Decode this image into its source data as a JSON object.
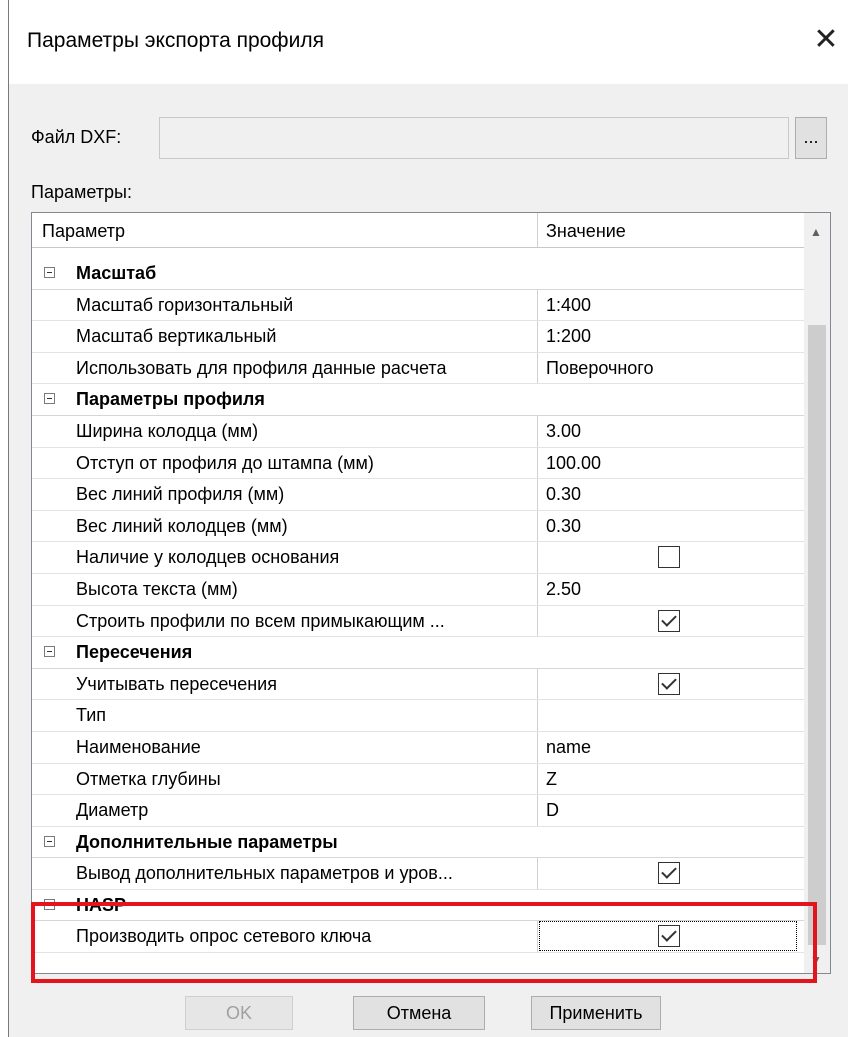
{
  "window": {
    "title": "Параметры экспорта профиля",
    "close_glyph": "✕"
  },
  "file": {
    "label": "Файл DXF:",
    "value": "",
    "browse_label": "..."
  },
  "params_label": "Параметры:",
  "grid": {
    "columns": [
      "Параметр",
      "Значение"
    ],
    "rows": [
      {
        "kind": "category",
        "name": "Масштаб"
      },
      {
        "kind": "item",
        "name": "Масштаб горизонтальный",
        "value": "1:400"
      },
      {
        "kind": "item",
        "name": "Масштаб вертикальный",
        "value": "1:200"
      },
      {
        "kind": "item",
        "name": "Использовать для профиля данные расчета",
        "value": "Поверочного"
      },
      {
        "kind": "category",
        "name": "Параметры профиля"
      },
      {
        "kind": "item",
        "name": "Ширина колодца (мм)",
        "value": "3.00"
      },
      {
        "kind": "item",
        "name": "Отступ от профиля до штампа (мм)",
        "value": "100.00"
      },
      {
        "kind": "item",
        "name": "Вес линий профиля (мм)",
        "value": "0.30"
      },
      {
        "kind": "item",
        "name": "Вес линий колодцев (мм)",
        "value": "0.30"
      },
      {
        "kind": "check",
        "name": "Наличие у колодцев основания",
        "checked": false
      },
      {
        "kind": "item",
        "name": "Высота текста (мм)",
        "value": "2.50"
      },
      {
        "kind": "check",
        "name": "Строить профили по всем примыкающим ...",
        "checked": true
      },
      {
        "kind": "category",
        "name": "Пересечения"
      },
      {
        "kind": "check",
        "name": "Учитывать пересечения",
        "checked": true
      },
      {
        "kind": "item",
        "name": "Тип",
        "value": ""
      },
      {
        "kind": "item",
        "name": "Наименование",
        "value": "name"
      },
      {
        "kind": "item",
        "name": "Отметка глубины",
        "value": "Z"
      },
      {
        "kind": "item",
        "name": "Диаметр",
        "value": "D"
      },
      {
        "kind": "category",
        "name": "Дополнительные параметры"
      },
      {
        "kind": "check",
        "name": "Вывод дополнительных параметров и уров...",
        "checked": true
      },
      {
        "kind": "category",
        "name": "HASP"
      },
      {
        "kind": "check",
        "name": "Производить опрос сетевого ключа",
        "checked": true,
        "focused": true
      }
    ]
  },
  "buttons": {
    "ok": "OK",
    "cancel": "Отмена",
    "apply": "Применить"
  }
}
